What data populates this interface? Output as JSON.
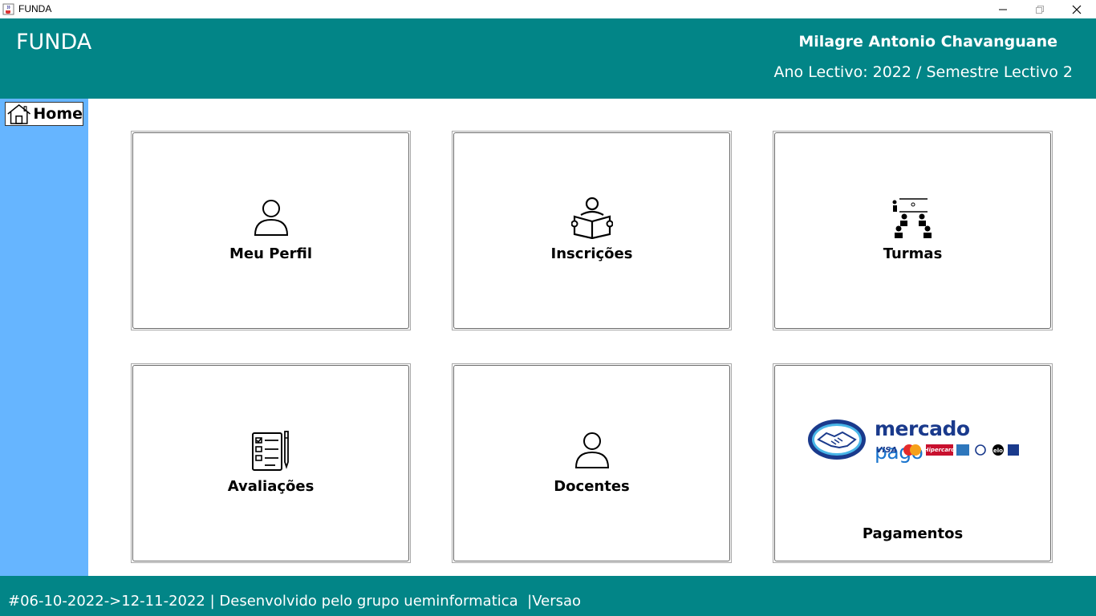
{
  "window": {
    "title": "FUNDA",
    "icon": "java-cup-icon"
  },
  "header": {
    "app_name": "FUNDA",
    "user_name": "Milagre Antonio Chavanguane",
    "year_info": "Ano Lectivo: 2022 / Semestre Lectivo 2"
  },
  "sidebar": {
    "home_label": "Home"
  },
  "cards": {
    "perfil": {
      "label": "Meu Perfil",
      "icon": "user-icon"
    },
    "inscricoes": {
      "label": "Inscrições",
      "icon": "reading-person-icon"
    },
    "turmas": {
      "label": "Turmas",
      "icon": "classroom-icon"
    },
    "avaliacoes": {
      "label": "Avaliações",
      "icon": "checklist-pen-icon"
    },
    "docentes": {
      "label": "Docentes",
      "icon": "user-icon"
    },
    "pagamentos": {
      "label": "Pagamentos",
      "logo": {
        "word1": "mercado",
        "word2": "pago",
        "cards": [
          "VISA",
          "Mastercard",
          "Hipercard",
          "Amex",
          "Diners Club",
          "elo",
          "Boleto"
        ]
      }
    }
  },
  "footer": {
    "text": "#06-10-2022->12-11-2022 | Desenvolvido pelo grupo ueminformatica  |Versao"
  },
  "colors": {
    "header": "#028587",
    "sidebar": "#66b5ff",
    "footer": "#028587"
  }
}
